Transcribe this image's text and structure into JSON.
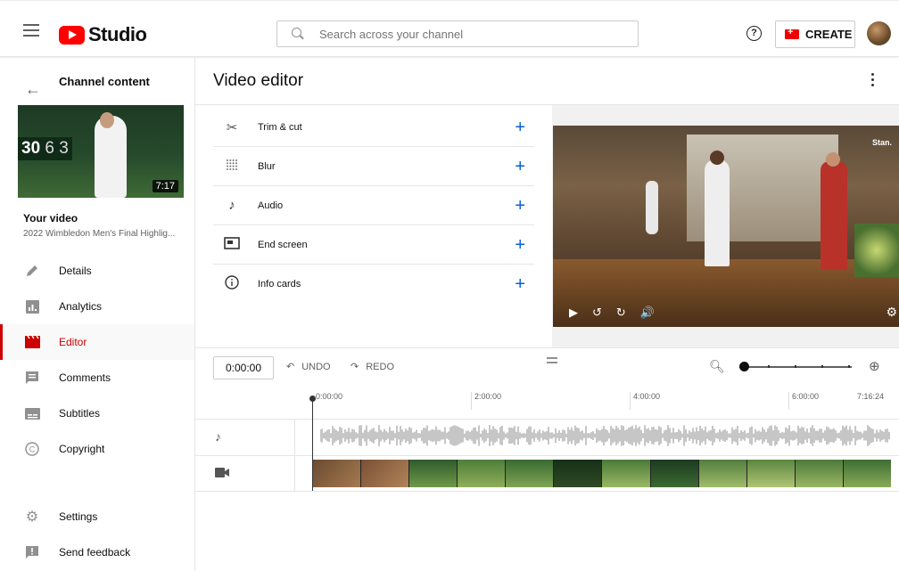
{
  "header": {
    "logo_text": "Studio",
    "search_placeholder": "Search across your channel",
    "create_label": "CREATE"
  },
  "sidebar": {
    "back_title": "Channel content",
    "thumbnail": {
      "score_main": "30",
      "score_rest": "6 3",
      "duration": "7:17"
    },
    "your_video_label": "Your video",
    "video_title": "2022 Wimbledon Men's Final Highlig...",
    "items": [
      {
        "label": "Details",
        "icon": "pencil-icon"
      },
      {
        "label": "Analytics",
        "icon": "analytics-icon"
      },
      {
        "label": "Editor",
        "icon": "editor-icon",
        "active": true
      },
      {
        "label": "Comments",
        "icon": "comments-icon"
      },
      {
        "label": "Subtitles",
        "icon": "subtitles-icon"
      },
      {
        "label": "Copyright",
        "icon": "copyright-icon"
      }
    ],
    "bottom_items": [
      {
        "label": "Settings",
        "icon": "gear-icon"
      },
      {
        "label": "Send feedback",
        "icon": "feedback-icon"
      }
    ]
  },
  "editor": {
    "title": "Video editor",
    "tools": [
      {
        "label": "Trim & cut",
        "icon": "scissors-icon"
      },
      {
        "label": "Blur",
        "icon": "blur-icon"
      },
      {
        "label": "Audio",
        "icon": "music-note-icon"
      },
      {
        "label": "End screen",
        "icon": "end-screen-icon"
      },
      {
        "label": "Info cards",
        "icon": "info-icon"
      }
    ],
    "player": {
      "watermark": "Stan."
    },
    "timeline": {
      "current_time": "0:00:00",
      "undo_label": "UNDO",
      "redo_label": "REDO",
      "ruler": [
        "0:00:00",
        "2:00:00",
        "4:00:00",
        "6:00:00",
        "7:16:24"
      ]
    }
  },
  "colors": {
    "accent": "#065fd4",
    "brand_red": "#ff0000",
    "active_red": "#cc0000"
  }
}
